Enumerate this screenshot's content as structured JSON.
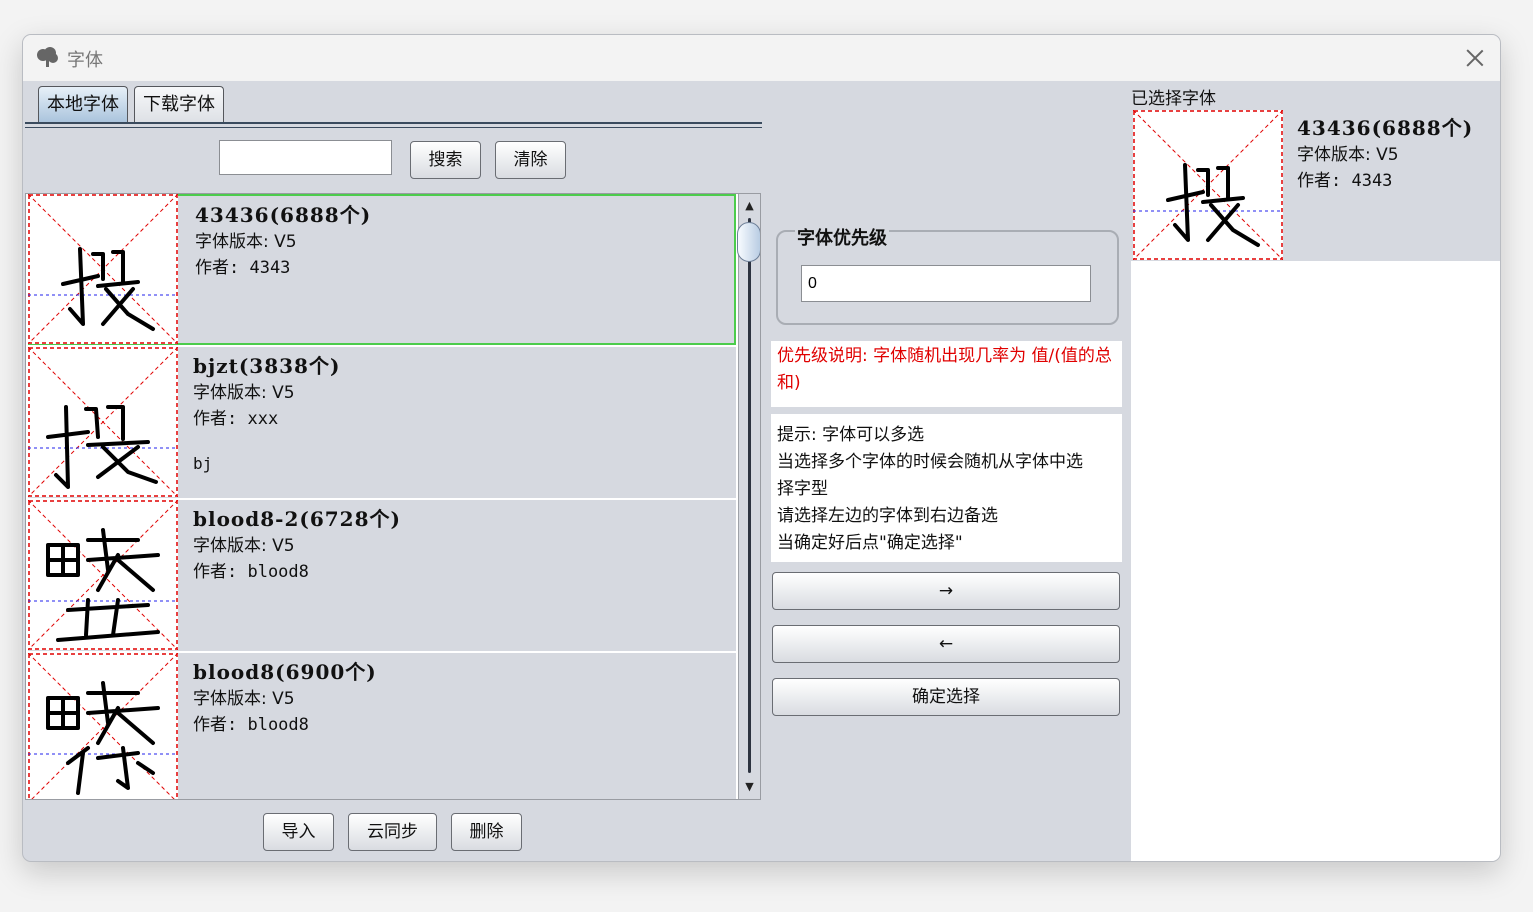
{
  "window": {
    "title": "字体"
  },
  "tabs": [
    {
      "label": "本地字体",
      "active": true
    },
    {
      "label": "下载字体",
      "active": false
    }
  ],
  "search": {
    "value": "",
    "search_label": "搜索",
    "clear_label": "清除"
  },
  "font_list": [
    {
      "name": "43436(6888个)",
      "version": "字体版本: V5",
      "author": "作者: 4343",
      "desc": "",
      "selected": true
    },
    {
      "name": "bjzt(3838个)",
      "version": "字体版本: V5",
      "author": "作者: xxx",
      "desc": "bj",
      "selected": false
    },
    {
      "name": "blood8-2(6728个)",
      "version": "字体版本: V5",
      "author": "作者: blood8",
      "desc": "",
      "selected": false
    },
    {
      "name": "blood8(6900个)",
      "version": "字体版本: V5",
      "author": "作者: blood8",
      "desc": "",
      "selected": false
    }
  ],
  "bottom_buttons": {
    "import_label": "导入",
    "sync_label": "云同步",
    "delete_label": "删除"
  },
  "priority": {
    "title": "字体优先级",
    "value": "0"
  },
  "priority_note": "优先级说明: 字体随机出现几率为 值/(值的总和)",
  "hint_lines": [
    "提示: 字体可以多选",
    "当选择多个字体的时候会随机从字体中选",
    "择字型",
    "请选择左边的字体到右边备选",
    "当确定好后点\"确定选择\""
  ],
  "actions": {
    "add_label": "→",
    "remove_label": "←",
    "confirm_label": "确定选择"
  },
  "selected_fonts": {
    "label": "已选择字体",
    "items": [
      {
        "name": "43436(6888个)",
        "version": "字体版本: V5",
        "author": "作者: 4343"
      }
    ]
  },
  "colors": {
    "window_bg": "#d6d9e0",
    "selected_border": "#4ccc4c",
    "note_red": "#e00000",
    "guide_red": "#e00000",
    "guide_blue": "#2222ee"
  }
}
